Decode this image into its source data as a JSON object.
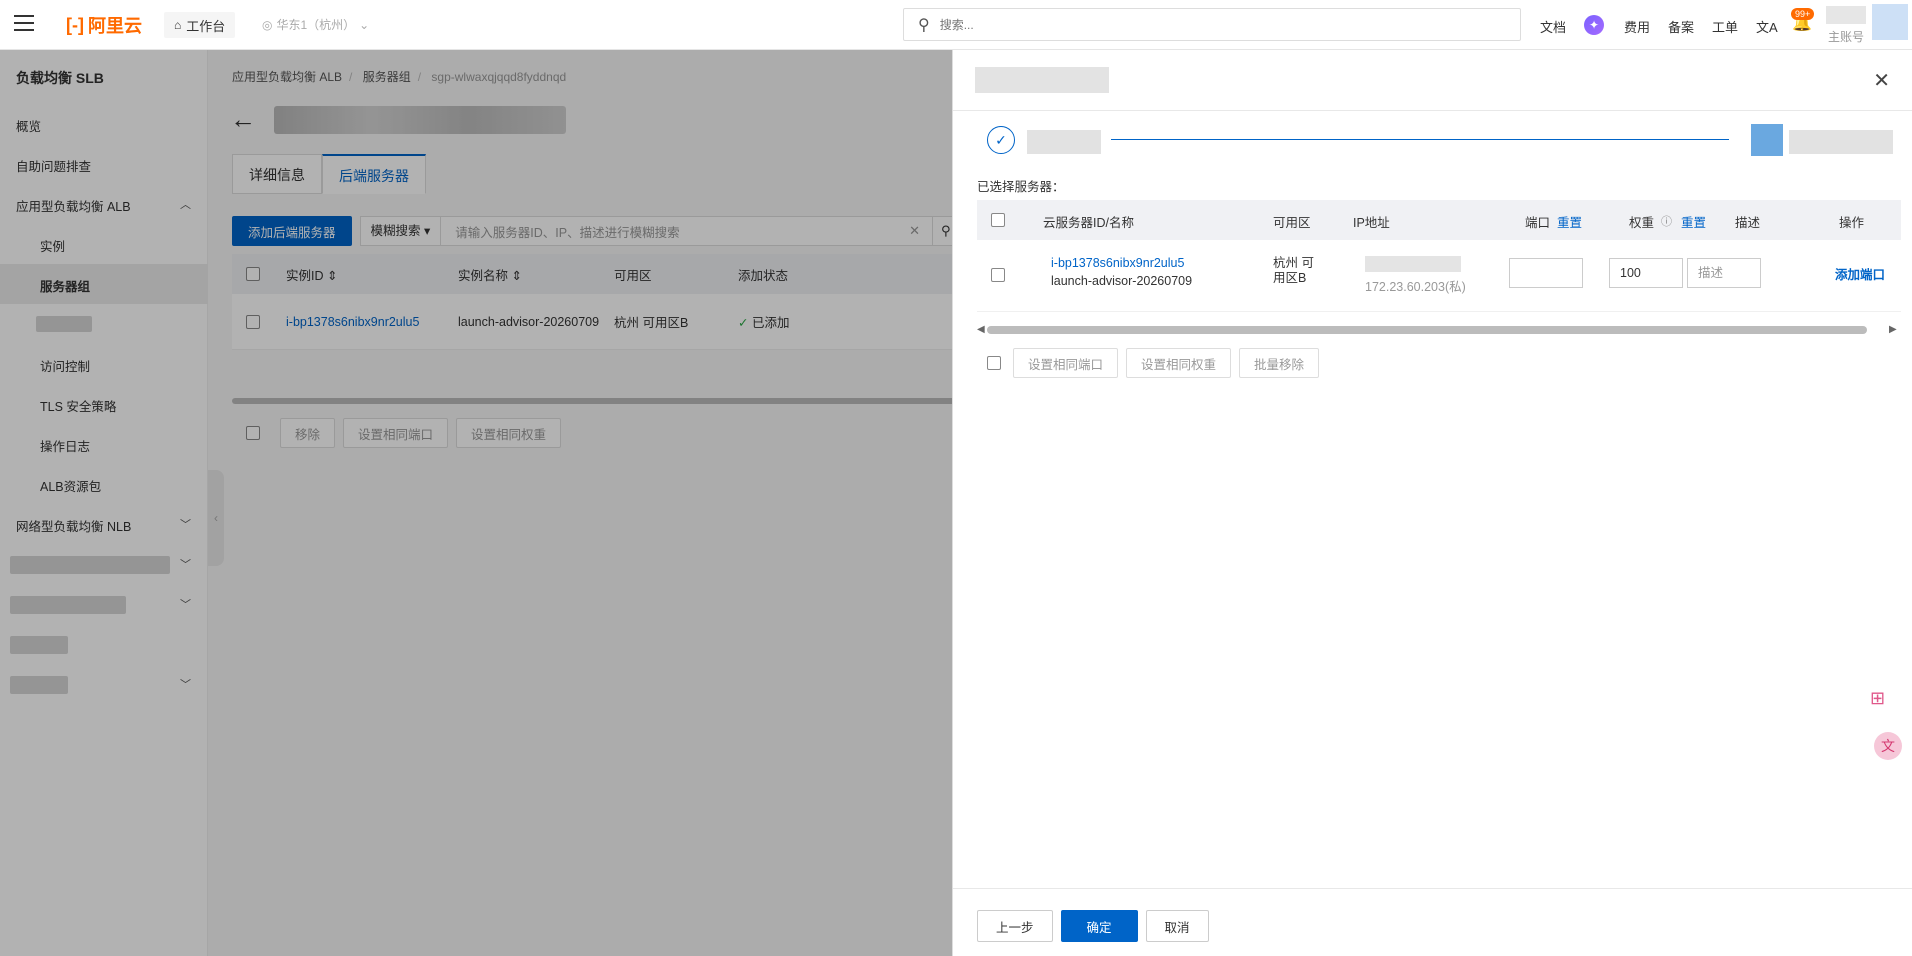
{
  "topbar": {
    "workbench": "工作台",
    "logo_text": "阿里云",
    "region": "华东1（杭州）",
    "search_placeholder": "搜索...",
    "nav": [
      "文档",
      "费用",
      "备案",
      "工单"
    ],
    "badge": "99+",
    "account_label": "主账号"
  },
  "sidebar": {
    "title": "负载均衡 SLB",
    "items": [
      {
        "label": "概览"
      },
      {
        "label": "自助问题排查"
      },
      {
        "label": "应用型负载均衡 ALB"
      },
      {
        "label": "实例"
      },
      {
        "label": "服务器组"
      },
      {
        "label": "访问控制"
      },
      {
        "label": "TLS 安全策略"
      },
      {
        "label": "操作日志"
      },
      {
        "label": "ALB资源包"
      },
      {
        "label": "网络型负载均衡 NLB"
      }
    ]
  },
  "main": {
    "breadcrumb": [
      "应用型负载均衡 ALB",
      "服务器组",
      "sgp-wlwaxqjqqd8fyddnqd"
    ],
    "tabs": [
      "详细信息",
      "后端服务器"
    ],
    "add_button": "添加后端服务器",
    "filter_select": "模糊搜索",
    "filter_placeholder": "请输入服务器ID、IP、描述进行模糊搜索",
    "columns": [
      "实例ID",
      "实例名称",
      "可用区",
      "添加状态"
    ],
    "rows": [
      {
        "id": "i-bp1378s6nibx9nr2ulu5",
        "name": "launch-advisor-20260709",
        "zone": "杭州 可用区B",
        "status": "已添加"
      }
    ],
    "actions": [
      "移除",
      "设置相同端口",
      "设置相同权重"
    ]
  },
  "drawer": {
    "selected_label": "已选择服务器：",
    "columns": {
      "server": "云服务器ID/名称",
      "zone": "可用区",
      "ip": "IP地址",
      "port": "端口",
      "port_reset": "重置",
      "weight": "权重",
      "weight_reset": "重置",
      "desc": "描述",
      "op": "操作"
    },
    "row": {
      "id": "i-bp1378s6nibx9nr2ulu5",
      "name": "launch-advisor-20260709",
      "zone": "杭州 可用区B",
      "ip": "172.23.60.203(私)",
      "port": "",
      "weight": "100",
      "desc_placeholder": "描述",
      "op": "添加端口"
    },
    "actions": [
      "设置相同端口",
      "设置相同权重",
      "批量移除"
    ],
    "footer": {
      "prev": "上一步",
      "confirm": "确定",
      "cancel": "取消"
    }
  }
}
